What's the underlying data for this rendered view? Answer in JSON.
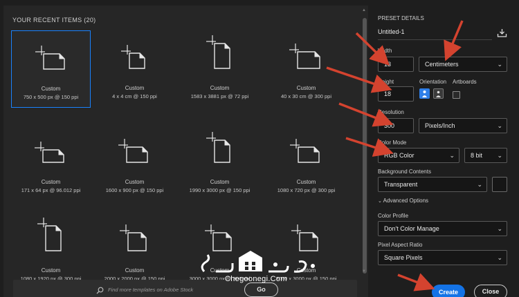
{
  "recent": {
    "title": "YOUR RECENT ITEMS  (20)",
    "items": [
      {
        "name": "Custom",
        "dims": "750 x 500 px @ 150 ppi"
      },
      {
        "name": "Custom",
        "dims": "4 x 4 cm @ 150 ppi"
      },
      {
        "name": "Custom",
        "dims": "1583 x 3881 px @ 72 ppi"
      },
      {
        "name": "Custom",
        "dims": "40 x 30 cm @ 300 ppi"
      },
      {
        "name": "Custom",
        "dims": "171 x 64 px @ 96.012 ppi"
      },
      {
        "name": "Custom",
        "dims": "1600 x 900 px @ 150 ppi"
      },
      {
        "name": "Custom",
        "dims": "1990 x 3000 px @ 150 ppi"
      },
      {
        "name": "Custom",
        "dims": "1080 x 720 px @ 300 ppi"
      },
      {
        "name": "Custom",
        "dims": "1080 x 1920 px @ 300 ppi"
      },
      {
        "name": "Custom",
        "dims": "2000 x 2000 px @ 150 ppi"
      },
      {
        "name": "Custom",
        "dims": "3000 x 3000 px @ 300 ppi"
      },
      {
        "name": "Custom",
        "dims": "3000 x 3000 px @ 150 ppi"
      }
    ]
  },
  "search": {
    "placeholder": "Find more templates on Adobe Stock",
    "go_label": "Go"
  },
  "preset": {
    "header": "PRESET DETAILS",
    "name": "Untitled-1",
    "width_label": "Width",
    "width_value": "13",
    "unit_value": "Centimeters",
    "height_label": "Height",
    "height_value": "18",
    "orientation_label": "Orientation",
    "artboards_label": "Artboards",
    "resolution_label": "Resolution",
    "resolution_value": "300",
    "resolution_unit": "Pixels/Inch",
    "color_mode_label": "Color Mode",
    "color_mode_value": "RGB Color",
    "bit_depth_value": "8 bit",
    "background_label": "Background Contents",
    "background_value": "Transparent",
    "advanced_label": "Advanced Options",
    "color_profile_label": "Color Profile",
    "color_profile_value": "Don't Color Manage",
    "aspect_label": "Pixel Aspect Ratio",
    "aspect_value": "Square Pixels"
  },
  "actions": {
    "create_label": "Create",
    "close_label": "Close"
  },
  "watermark": {
    "site": "Chegoonegi.Com"
  },
  "colors": {
    "accent": "#1473e6",
    "annotation_arrow": "#d4432f"
  },
  "icons": [
    "search-icon",
    "save-preset-icon",
    "portrait-icon",
    "landscape-icon",
    "chevron-down-icon",
    "chevron-right-icon"
  ]
}
